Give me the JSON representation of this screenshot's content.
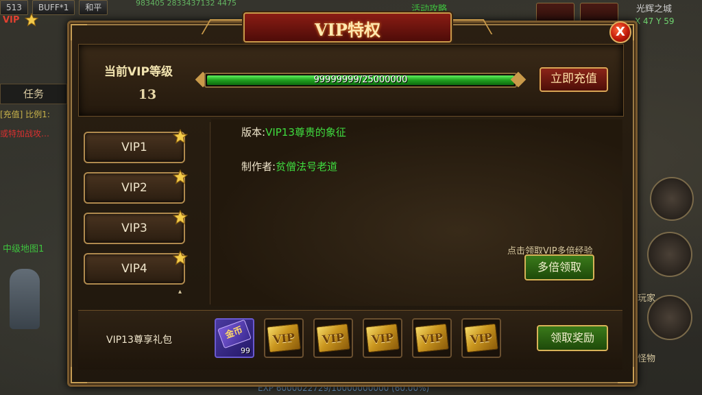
{
  "hud": {
    "level": "513",
    "buff": "BUFF*1",
    "mode": "和平",
    "top_stats": "983405 2833437132 4475",
    "vip": "VIP",
    "task": "任务",
    "chat_1": "[充值] 比例1:",
    "chat_2": "或特加战攻…",
    "map_label": "中级地图1",
    "top_middle": "活动攻略",
    "map_name": "光辉之城",
    "map_coords": "X 47 Y 59",
    "side_1": "玩家",
    "side_2": "怪物",
    "exp": "EXP 6000022729/10000000000 (60.00%)"
  },
  "panel": {
    "title": "VIP特权",
    "close": "X",
    "current_level_label": "当前VIP等级",
    "current_level": "13",
    "progress_text": "99999999/25000000",
    "progress": 1.0,
    "recharge_button": "立即充值"
  },
  "vip_list": {
    "items": [
      {
        "label": "VIP1"
      },
      {
        "label": "VIP2"
      },
      {
        "label": "VIP3"
      },
      {
        "label": "VIP4"
      }
    ]
  },
  "info": {
    "version_label": "版本:",
    "version_value": "VIP13尊贵的象征",
    "author_label": "制作者:",
    "author_value": "贫僧法号老道",
    "hint": "点击领取VIP多倍经验",
    "multi_button": "多倍领取"
  },
  "rewards": {
    "label": "VIP13尊享礼包",
    "slots": [
      {
        "type": "purple",
        "text": "金币",
        "count": "99"
      },
      {
        "type": "gold",
        "text": "VIP"
      },
      {
        "type": "gold",
        "text": "VIP"
      },
      {
        "type": "gold",
        "text": "VIP"
      },
      {
        "type": "gold",
        "text": "VIP"
      },
      {
        "type": "gold",
        "text": "VIP"
      }
    ],
    "claim_button": "领取奖励"
  },
  "colors": {
    "accent_gold": "#c99a4a",
    "green_text": "#3fdc3f",
    "progress_green": "#1fa01f",
    "red_button": "#8a2418"
  },
  "icons": {
    "star": "star-icon",
    "close": "close-icon",
    "coupon": "vip-coupon-icon",
    "gold_card": "gold-card-icon"
  }
}
